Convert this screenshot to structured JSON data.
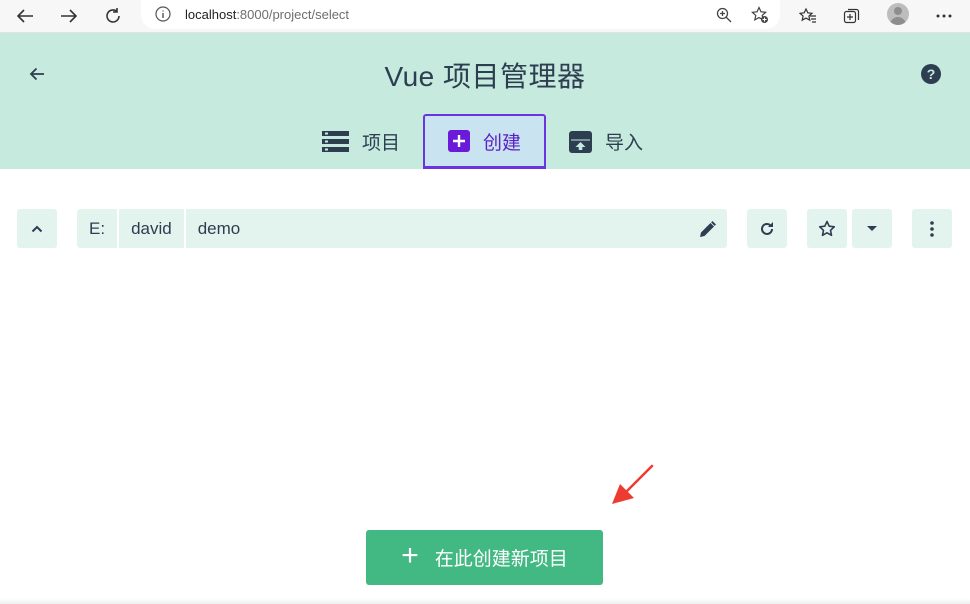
{
  "browser": {
    "url_host": "localhost",
    "url_path": ":8000/project/select"
  },
  "header": {
    "title": "Vue 项目管理器",
    "help_label": "?"
  },
  "tabs": [
    {
      "label": "项目",
      "icon": "list-icon",
      "active": false
    },
    {
      "label": "创建",
      "icon": "plus-box-icon",
      "active": true
    },
    {
      "label": "导入",
      "icon": "archive-icon",
      "active": false
    }
  ],
  "path": {
    "segments": [
      "E:",
      "david",
      "demo"
    ]
  },
  "create": {
    "plus": "+",
    "label": "在此创建新项目"
  },
  "colors": {
    "header_bg": "#c6eade",
    "accent": "#42b883",
    "active_tab": "#6a35e0",
    "text": "#2c3e50",
    "annotation": "#ee3b32"
  }
}
